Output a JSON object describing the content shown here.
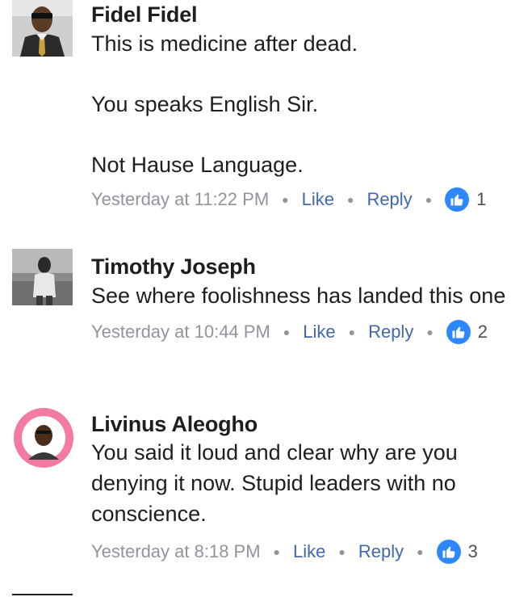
{
  "comments": [
    {
      "author": "Fidel Fidel",
      "text": [
        "This is medicine after dead.",
        "You speaks English Sir.",
        "Not Hause Language."
      ],
      "time": "Yesterday at 11:22 PM",
      "like_label": "Like",
      "reply_label": "Reply",
      "reaction_icon": "thumbs-up-icon",
      "reaction_count": "1"
    },
    {
      "author": "Timothy Joseph",
      "text": [
        "See where foolishness has landed this one"
      ],
      "time": "Yesterday at 10:44 PM",
      "like_label": "Like",
      "reply_label": "Reply",
      "reaction_icon": "thumbs-up-icon",
      "reaction_count": "2"
    },
    {
      "author": "Livinus Aleogho",
      "text": [
        "You said it loud and clear why are you denying it now. Stupid leaders with no conscience."
      ],
      "time": "Yesterday at 8:18 PM",
      "like_label": "Like",
      "reply_label": "Reply",
      "reaction_icon": "thumbs-up-icon",
      "reaction_count": "3"
    }
  ],
  "colors": {
    "link": "#4267b2",
    "meta": "#90949c",
    "like_badge": "#2d88ff"
  }
}
